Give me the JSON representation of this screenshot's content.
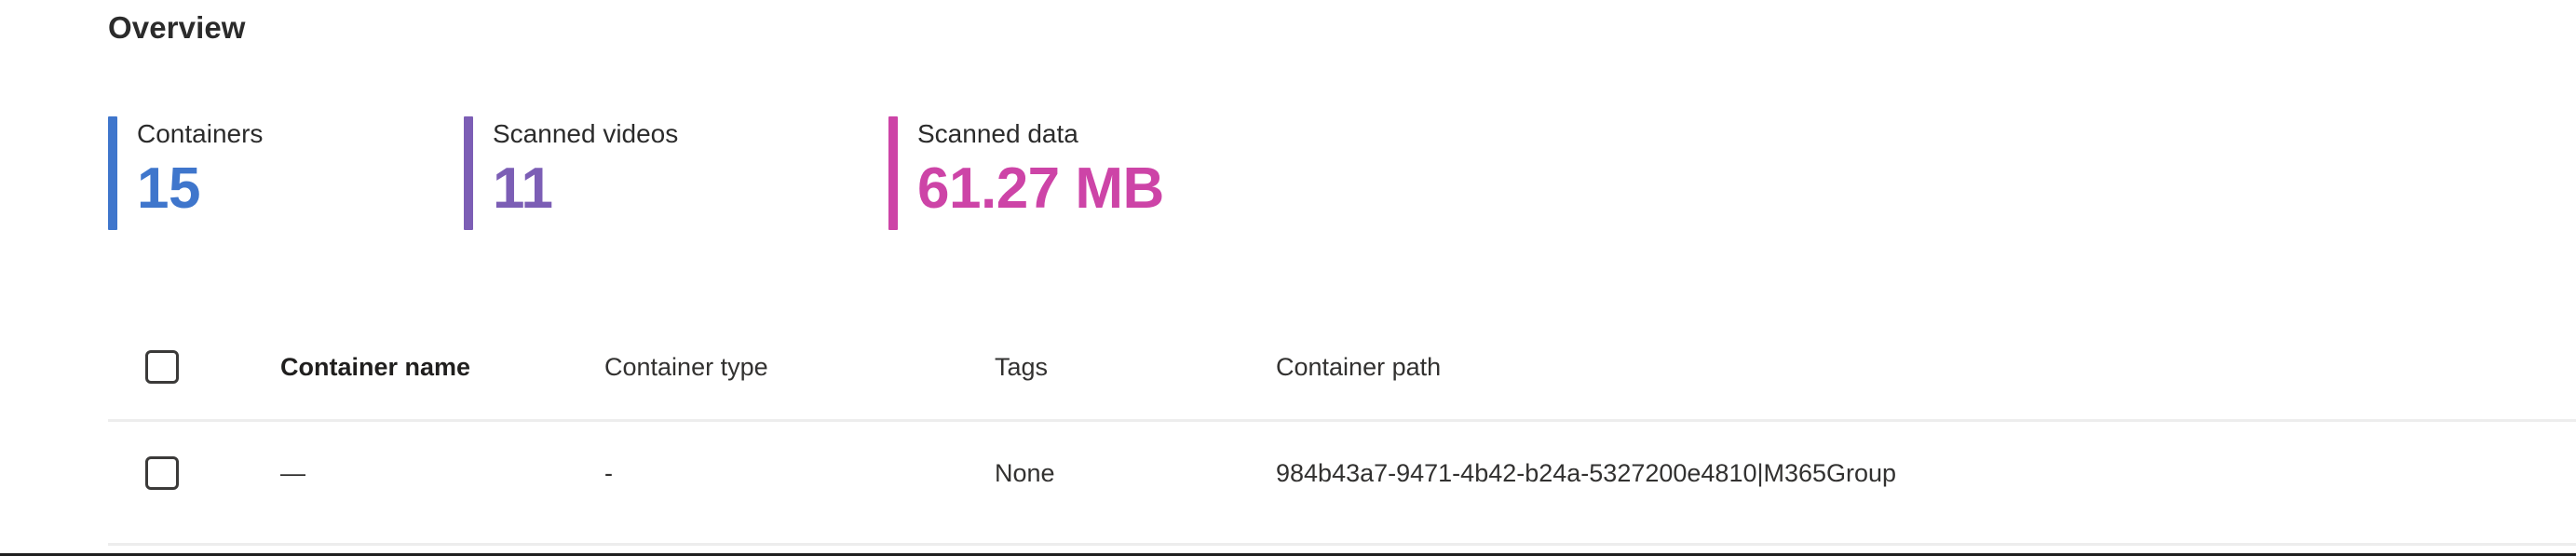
{
  "section": {
    "title": "Overview"
  },
  "metrics": [
    {
      "label": "Containers",
      "value": "15",
      "color": "#3f76cc",
      "name": "containers"
    },
    {
      "label": "Scanned videos",
      "value": "11",
      "color": "#7c5eb5",
      "name": "scanned-videos"
    },
    {
      "label": "Scanned data",
      "value": "61.27 MB",
      "color": "#cd44a7",
      "name": "scanned-data"
    }
  ],
  "table": {
    "select_all_checkbox": {
      "checked": false,
      "icon": "checkbox-unchecked-icon"
    },
    "columns": [
      {
        "key": "name",
        "label": "Container name",
        "primary": true
      },
      {
        "key": "type",
        "label": "Container type",
        "primary": false
      },
      {
        "key": "tags",
        "label": "Tags",
        "primary": false
      },
      {
        "key": "path",
        "label": "Container path",
        "primary": false
      }
    ],
    "rows": [
      {
        "checkbox": {
          "checked": false,
          "icon": "checkbox-unchecked-icon"
        },
        "name": "—",
        "type": "-",
        "tags": "None",
        "path": "984b43a7-9471-4b42-b24a-5327200e4810|M365Group"
      }
    ]
  }
}
